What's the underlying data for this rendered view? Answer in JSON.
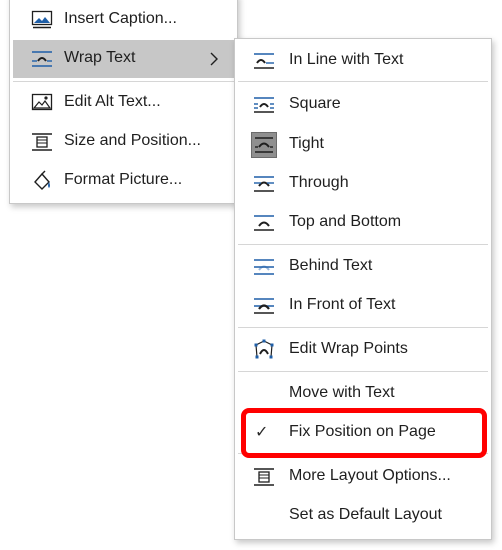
{
  "context_menu": {
    "items": [
      {
        "label": "Insert Caption...",
        "icon": "insert-caption-icon"
      },
      {
        "label": "Wrap Text",
        "icon": "wrap-text-icon",
        "submenu_arrow": "chevron-right-icon"
      },
      {
        "label": "Edit Alt Text...",
        "icon": "alt-text-icon"
      },
      {
        "label": "Size and Position...",
        "icon": "size-position-icon"
      },
      {
        "label": "Format Picture...",
        "icon": "format-picture-icon"
      }
    ]
  },
  "wrap_text_submenu": {
    "items": [
      {
        "label": "In Line with Text",
        "icon": "inline-with-text-icon"
      },
      {
        "label": "Square",
        "icon": "square-wrap-icon"
      },
      {
        "label": "Tight",
        "icon": "tight-wrap-icon",
        "selected": true
      },
      {
        "label": "Through",
        "icon": "through-wrap-icon"
      },
      {
        "label": "Top and Bottom",
        "icon": "top-bottom-wrap-icon"
      },
      {
        "label": "Behind Text",
        "icon": "behind-text-icon"
      },
      {
        "label": "In Front of Text",
        "icon": "in-front-of-text-icon"
      },
      {
        "label": "Edit Wrap Points",
        "icon": "edit-wrap-points-icon"
      },
      {
        "label": "Move with Text"
      },
      {
        "label": "Fix Position on Page",
        "checked": true,
        "check_glyph": "✓"
      },
      {
        "label": "More Layout Options...",
        "icon": "layout-options-icon"
      },
      {
        "label": "Set as Default Layout"
      }
    ]
  },
  "colors": {
    "hover_bg": "#c7c7c7",
    "icon_blue": "#1f5fa8",
    "icon_dark": "#1f1f1f",
    "highlight": "#ff0000"
  }
}
